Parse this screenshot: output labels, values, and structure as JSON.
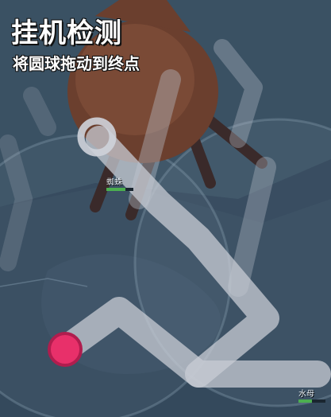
{
  "header": {
    "title": "挂机检测",
    "instruction": "将圆球拖动到终点"
  },
  "units": [
    {
      "id": "unit-upper",
      "name": "蜘蛛",
      "hp": 0.7
    },
    {
      "id": "unit-lower",
      "name": "水母",
      "hp": 0.5
    }
  ],
  "puzzle": {
    "ball_color": "#e8306a",
    "path_color": "#c8ccd4",
    "goal": "ring-end"
  },
  "colors": {
    "background": "#2f4357",
    "creature_body": "#6b3f2e"
  }
}
